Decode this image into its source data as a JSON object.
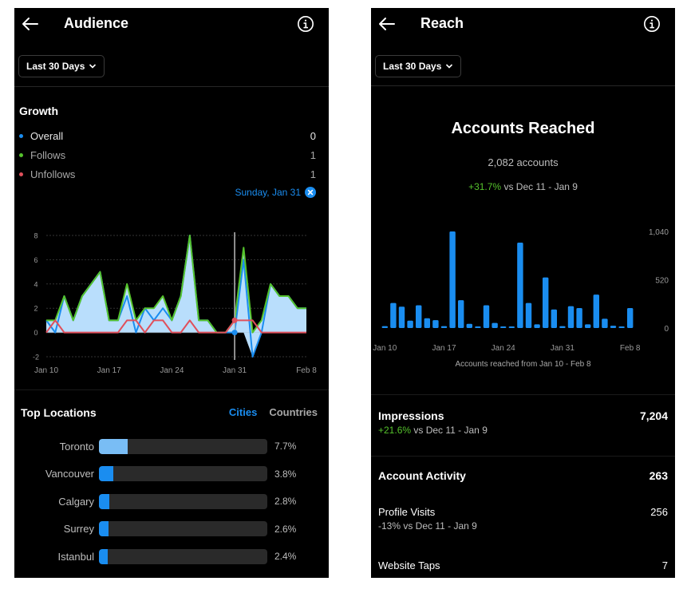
{
  "audience": {
    "header": {
      "title": "Audience",
      "back_icon": "arrow-left-icon",
      "info_icon": "info-circle-icon"
    },
    "date_filter": {
      "label": "Last 30 Days",
      "icon": "chevron-down-icon"
    },
    "growth": {
      "title": "Growth",
      "legend": [
        {
          "label": "Overall",
          "value": "0",
          "color": "#1a8df0"
        },
        {
          "label": "Follows",
          "value": "1",
          "color": "#55c22c"
        },
        {
          "label": "Unfollows",
          "value": "1",
          "color": "#e0505c"
        }
      ],
      "selected_date": "Sunday, Jan 31",
      "clear_icon": "close-circle-icon"
    },
    "top_locations": {
      "title": "Top Locations",
      "tabs": [
        {
          "label": "Cities",
          "active": true
        },
        {
          "label": "Countries",
          "active": false
        }
      ],
      "items": [
        {
          "name": "Toronto",
          "percent_label": "7.7%",
          "percent": 7.7
        },
        {
          "name": "Vancouver",
          "percent_label": "3.8%",
          "percent": 3.8
        },
        {
          "name": "Calgary",
          "percent_label": "2.8%",
          "percent": 2.8
        },
        {
          "name": "Surrey",
          "percent_label": "2.6%",
          "percent": 2.6
        },
        {
          "name": "Istanbul",
          "percent_label": "2.4%",
          "percent": 2.4
        }
      ]
    }
  },
  "reach": {
    "header": {
      "title": "Reach",
      "back_icon": "arrow-left-icon",
      "info_icon": "info-circle-icon"
    },
    "date_filter": {
      "label": "Last 30 Days",
      "icon": "chevron-down-icon"
    },
    "accounts_reached": {
      "title": "Accounts Reached",
      "count": "2,082 accounts",
      "change": "+31.7%",
      "change_suffix": " vs Dec 11 - Jan 9",
      "caption": "Accounts reached from Jan 10 - Feb 8"
    },
    "impressions": {
      "label": "Impressions",
      "value": "7,204",
      "change": "+21.6%",
      "change_suffix": " vs Dec 11 - Jan 9"
    },
    "account_activity": {
      "label": "Account Activity",
      "value": "263"
    },
    "profile_visits": {
      "label": "Profile Visits",
      "value": "256",
      "change": "-13% vs Dec 11 - Jan 9"
    },
    "website_taps": {
      "label": "Website Taps",
      "value": "7"
    }
  },
  "chart_data": [
    {
      "type": "line",
      "title": "Growth",
      "x": [
        "Jan 10",
        "Jan 11",
        "Jan 12",
        "Jan 13",
        "Jan 14",
        "Jan 15",
        "Jan 16",
        "Jan 17",
        "Jan 18",
        "Jan 19",
        "Jan 20",
        "Jan 21",
        "Jan 22",
        "Jan 23",
        "Jan 24",
        "Jan 25",
        "Jan 26",
        "Jan 27",
        "Jan 28",
        "Jan 29",
        "Jan 30",
        "Jan 31",
        "Feb 1",
        "Feb 2",
        "Feb 3",
        "Feb 4",
        "Feb 5",
        "Feb 6",
        "Feb 7",
        "Feb 8"
      ],
      "xticks": [
        "Jan 10",
        "Jan 17",
        "Jan 24",
        "Jan 31",
        "Feb 8"
      ],
      "yticks": [
        -2,
        0,
        2,
        4,
        6,
        8
      ],
      "ylim": [
        -2,
        8
      ],
      "grid": true,
      "highlight_x": "Jan 31",
      "series": [
        {
          "name": "Overall",
          "color": "#1a8df0",
          "values": [
            1,
            0,
            3,
            1,
            3,
            4,
            5,
            1,
            1,
            3,
            0,
            2,
            1,
            2,
            1,
            3,
            8,
            1,
            1,
            0,
            0,
            0,
            6,
            -2,
            0,
            4,
            3,
            3,
            2,
            2
          ]
        },
        {
          "name": "Follows",
          "color": "#55c22c",
          "values": [
            1,
            1,
            3,
            1,
            3,
            4,
            5,
            1,
            1,
            4,
            1,
            2,
            2,
            3,
            1,
            3,
            8,
            1,
            1,
            0,
            0,
            1,
            7,
            0,
            1,
            4,
            3,
            3,
            2,
            2
          ]
        },
        {
          "name": "Unfollows",
          "color": "#e0505c",
          "values": [
            0,
            1,
            0,
            0,
            0,
            0,
            0,
            0,
            0,
            1,
            1,
            0,
            1,
            1,
            0,
            0,
            1,
            0,
            0,
            0,
            0,
            1,
            1,
            1,
            0,
            0,
            0,
            0,
            0,
            0
          ]
        }
      ]
    },
    {
      "type": "bar",
      "title": "Accounts Reached",
      "categories": [
        "Jan 10",
        "Jan 11",
        "Jan 12",
        "Jan 13",
        "Jan 14",
        "Jan 15",
        "Jan 16",
        "Jan 17",
        "Jan 18",
        "Jan 19",
        "Jan 20",
        "Jan 21",
        "Jan 22",
        "Jan 23",
        "Jan 24",
        "Jan 25",
        "Jan 26",
        "Jan 27",
        "Jan 28",
        "Jan 29",
        "Jan 30",
        "Jan 31",
        "Feb 1",
        "Feb 2",
        "Feb 3",
        "Feb 4",
        "Feb 5",
        "Feb 6",
        "Feb 7",
        "Feb 8"
      ],
      "xticks": [
        "Jan 10",
        "Jan 17",
        "Jan 24",
        "Jan 31",
        "Feb 8"
      ],
      "yticks": [
        "0",
        "520",
        "1,040"
      ],
      "ylim": [
        0,
        1040
      ],
      "values": [
        20,
        270,
        230,
        80,
        245,
        105,
        85,
        20,
        1040,
        300,
        45,
        15,
        245,
        55,
        10,
        10,
        920,
        270,
        40,
        545,
        200,
        20,
        235,
        215,
        40,
        360,
        100,
        25,
        10,
        215
      ],
      "color": "#1a8df0",
      "caption": "Accounts reached from Jan 10 - Feb 8"
    }
  ]
}
